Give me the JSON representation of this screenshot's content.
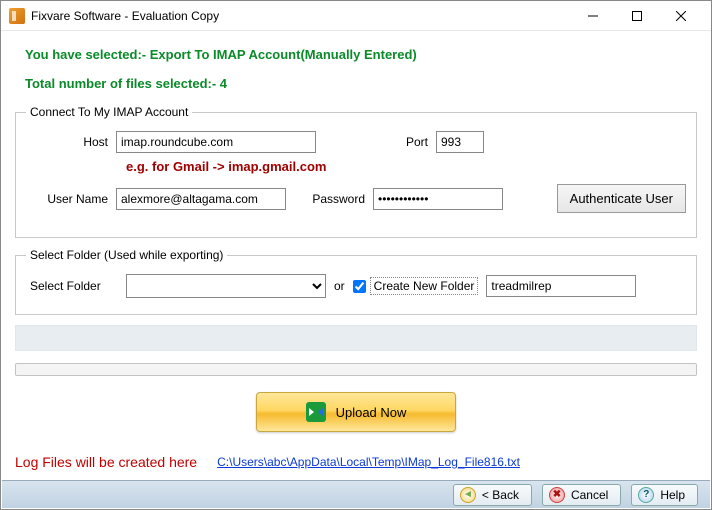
{
  "window": {
    "title": "Fixvare Software - Evaluation Copy"
  },
  "status": {
    "selection": "You have selected:- Export To IMAP Account(Manually Entered)",
    "file_count": "Total number of files selected:- 4"
  },
  "imap": {
    "legend": "Connect To My IMAP Account",
    "host_label": "Host",
    "host_value": "imap.roundcube.com",
    "port_label": "Port",
    "port_value": "993",
    "hint": "e.g. for Gmail -> imap.gmail.com",
    "user_label": "User Name",
    "user_value": "alexmore@altagama.com",
    "pass_label": "Password",
    "pass_value": "************",
    "auth_btn": "Authenticate User"
  },
  "folder": {
    "legend": "Select Folder (Used while exporting)",
    "select_label": "Select Folder",
    "or_text": "or",
    "create_label": "Create New Folder",
    "create_checked": true,
    "new_name": "treadmilrep"
  },
  "upload_btn": "Upload Now",
  "log": {
    "label": "Log Files will be created here",
    "path": "C:\\Users\\abc\\AppData\\Local\\Temp\\IMap_Log_File816.txt"
  },
  "footer": {
    "back": "< Back",
    "cancel": "Cancel",
    "help": "Help"
  }
}
